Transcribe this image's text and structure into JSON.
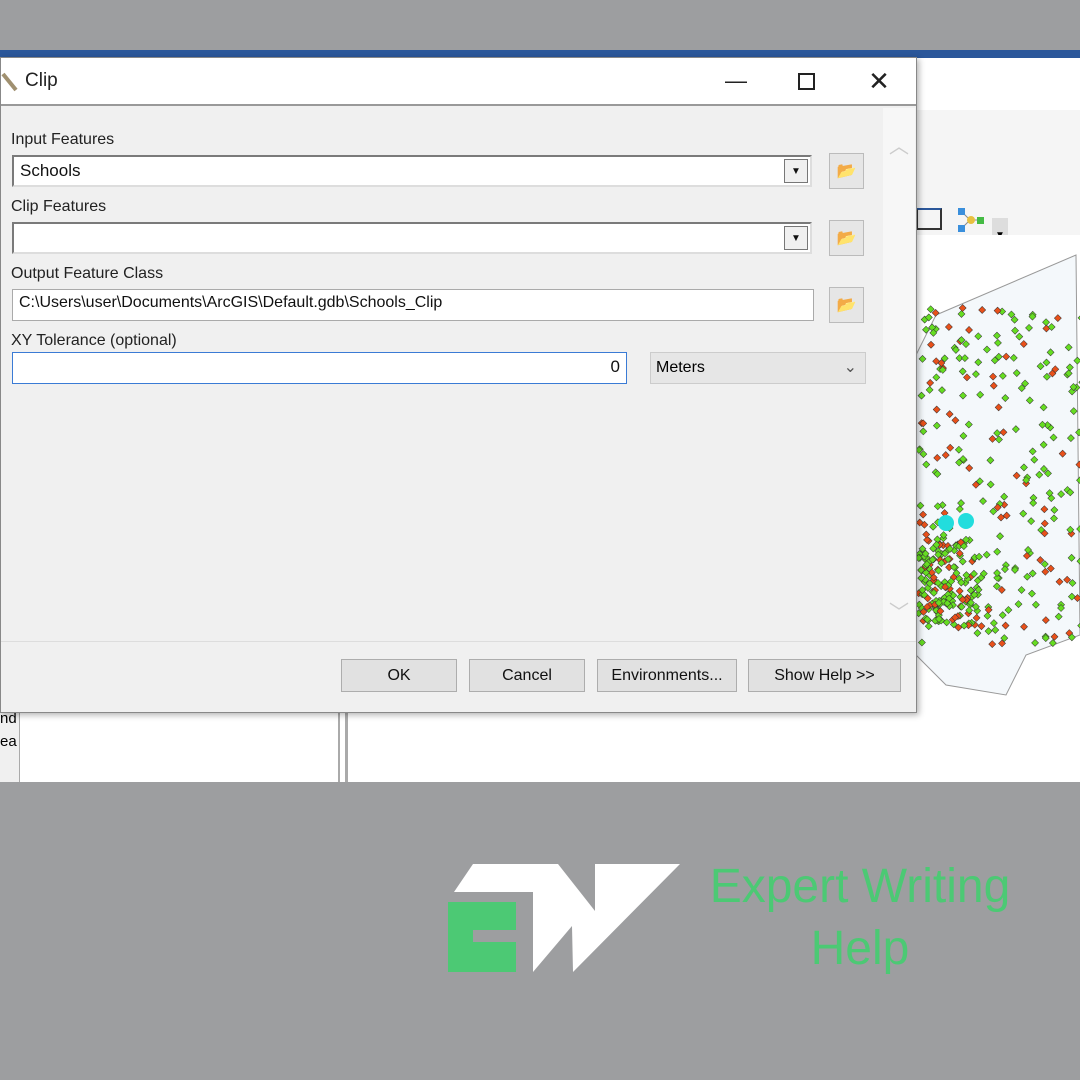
{
  "dialog": {
    "title": "Clip",
    "minimize_icon": "minimize-icon",
    "maximize_icon": "maximize-icon",
    "close_icon": "close-icon",
    "fields": [
      {
        "label": "Input Features",
        "value": "Schools"
      },
      {
        "label": "Clip Features",
        "value": ""
      },
      {
        "label": "Output Feature Class",
        "value": "C:\\Users\\user\\Documents\\ArcGIS\\Default.gdb\\Schools_Clip"
      },
      {
        "label": "XY Tolerance (optional)",
        "value": "0",
        "unit": "Meters"
      }
    ],
    "buttons": {
      "ok": "OK",
      "cancel": "Cancel",
      "environments": "Environments...",
      "show_help": "Show Help >>"
    }
  },
  "background_app": {
    "left_panel_fragments": [
      "nd",
      "ea"
    ]
  },
  "watermark": {
    "logo_text": "EW",
    "line1": "Expert Writing",
    "line2": "Help",
    "color": "#4cc974"
  },
  "colors": {
    "title_blue": "#2b579a",
    "school_green": "#66dd22",
    "school_orange": "#e8501a",
    "highlight_cyan": "#22dddd"
  }
}
